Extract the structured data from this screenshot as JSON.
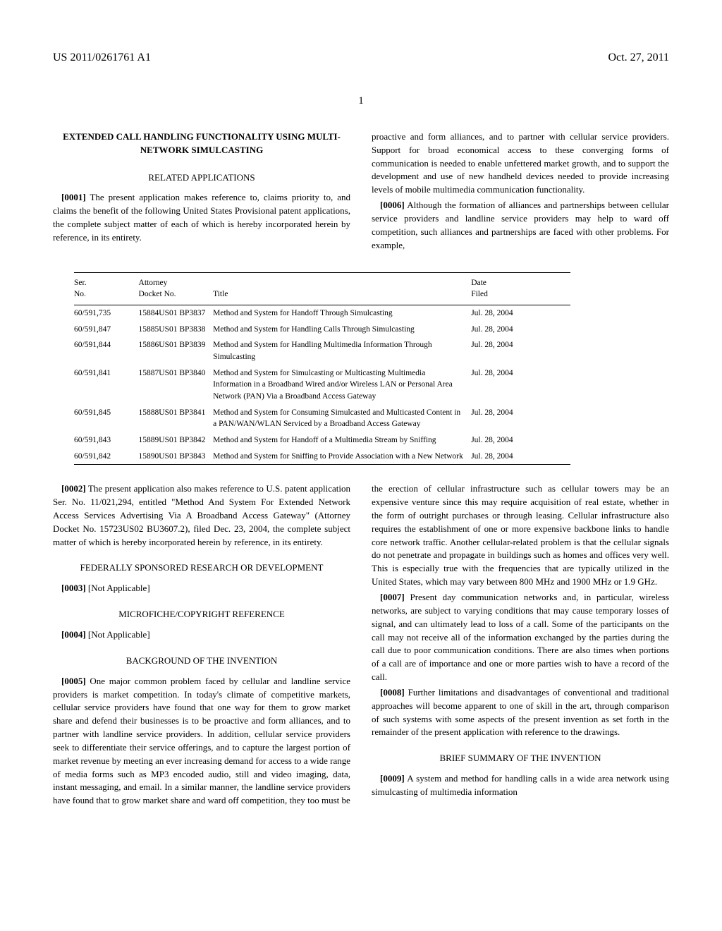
{
  "header": {
    "pub_number": "US 2011/0261761 A1",
    "date": "Oct. 27, 2011"
  },
  "page_number": "1",
  "left_col": {
    "title": "EXTENDED CALL HANDLING FUNCTIONALITY USING MULTI-NETWORK SIMULCASTING",
    "section1": "RELATED APPLICATIONS",
    "p1_num": "[0001]",
    "p1": "The present application makes reference to, claims priority to, and claims the benefit of the following United States Provisional patent applications, the complete subject matter of each of which is hereby incorporated herein by reference, in its entirety.",
    "p2_num": "[0002]",
    "p2": "The present application also makes reference to U.S. patent application Ser. No. 11/021,294, entitled \"Method And System For Extended Network Access Services Advertising Via A Broadband Access Gateway\" (Attorney Docket No. 15723US02 BU3607.2), filed Dec. 23, 2004, the complete subject matter of which is hereby incorporated herein by reference, in its entirety.",
    "section2": "FEDERALLY SPONSORED RESEARCH OR DEVELOPMENT",
    "p3_num": "[0003]",
    "p3": "[Not Applicable]",
    "section3": "MICROFICHE/COPYRIGHT REFERENCE",
    "p4_num": "[0004]",
    "p4": "[Not Applicable]",
    "section4": "BACKGROUND OF THE INVENTION",
    "p5_num": "[0005]",
    "p5": "One major common problem faced by cellular and landline service providers is market competition. In today's climate of competitive markets, cellular service providers have found that one way for them to grow market share and defend their businesses is to be proactive and form alliances, and to partner with landline service providers. In addition, cellular service providers seek to differentiate their service offerings, and to capture the largest portion of market revenue by meeting an ever increasing demand for access to a wide range of media forms such as MP3 encoded audio, still and video imaging, data, instant messaging, and email. In a similar manner, the landline service providers have found that to grow market share and ward off competition, they too must be"
  },
  "right_col": {
    "p5_cont": "proactive and form alliances, and to partner with cellular service providers. Support for broad economical access to these converging forms of communication is needed to enable unfettered market growth, and to support the development and use of new handheld devices needed to provide increasing levels of mobile multimedia communication functionality.",
    "p6_num": "[0006]",
    "p6": "Although the formation of alliances and partnerships between cellular service providers and landline service providers may help to ward off competition, such alliances and partnerships are faced with other problems. For example,",
    "p6_cont": "the erection of cellular infrastructure such as cellular towers may be an expensive venture since this may require acquisition of real estate, whether in the form of outright purchases or through leasing. Cellular infrastructure also requires the establishment of one or more expensive backbone links to handle core network traffic. Another cellular-related problem is that the cellular signals do not penetrate and propagate in buildings such as homes and offices very well. This is especially true with the frequencies that are typically utilized in the United States, which may vary between 800 MHz and 1900 MHz or 1.9 GHz.",
    "p7_num": "[0007]",
    "p7": "Present day communication networks and, in particular, wireless networks, are subject to varying conditions that may cause temporary losses of signal, and can ultimately lead to loss of a call. Some of the participants on the call may not receive all of the information exchanged by the parties during the call due to poor communication conditions. There are also times when portions of a call are of importance and one or more parties wish to have a record of the call.",
    "p8_num": "[0008]",
    "p8": "Further limitations and disadvantages of conventional and traditional approaches will become apparent to one of skill in the art, through comparison of such systems with some aspects of the present invention as set forth in the remainder of the present application with reference to the drawings.",
    "section5": "BRIEF SUMMARY OF THE INVENTION",
    "p9_num": "[0009]",
    "p9": "A system and method for handling calls in a wide area network using simulcasting of multimedia information"
  },
  "table": {
    "headers": {
      "c1a": "Ser.",
      "c1b": "No.",
      "c2a": "Attorney",
      "c2b": "Docket No.",
      "c3": "Title",
      "c4a": "Date",
      "c4b": "Filed"
    },
    "rows": [
      {
        "ser": "60/591,735",
        "docket": "15884US01 BP3837",
        "title": "Method and System for Handoff Through Simulcasting",
        "date": "Jul. 28, 2004"
      },
      {
        "ser": "60/591,847",
        "docket": "15885US01 BP3838",
        "title": "Method and System for Handling Calls Through Simulcasting",
        "date": "Jul. 28, 2004"
      },
      {
        "ser": "60/591,844",
        "docket": "15886US01 BP3839",
        "title": "Method and System for Handling Multimedia Information Through Simulcasting",
        "date": "Jul. 28, 2004"
      },
      {
        "ser": "60/591,841",
        "docket": "15887US01 BP3840",
        "title": "Method and System for Simulcasting or Multicasting Multimedia Information in a Broadband Wired and/or Wireless LAN or Personal Area Network (PAN) Via a Broadband Access Gateway",
        "date": "Jul. 28, 2004"
      },
      {
        "ser": "60/591,845",
        "docket": "15888US01 BP3841",
        "title": "Method and System for Consuming Simulcasted and Multicasted Content in a PAN/WAN/WLAN Serviced by a Broadband Access Gateway",
        "date": "Jul. 28, 2004"
      },
      {
        "ser": "60/591,843",
        "docket": "15889US01 BP3842",
        "title": "Method and System for Handoff of a Multimedia Stream by Sniffing",
        "date": "Jul. 28, 2004"
      },
      {
        "ser": "60/591,842",
        "docket": "15890US01 BP3843",
        "title": "Method and System for Sniffing to Provide Association with a New Network",
        "date": "Jul. 28, 2004"
      }
    ]
  }
}
